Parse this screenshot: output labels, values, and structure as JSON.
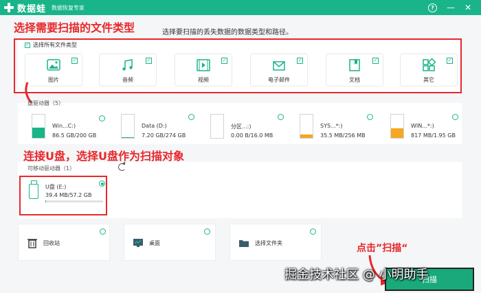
{
  "titlebar": {
    "app_name": "数据蛙",
    "app_subtitle": "数据恢复专家",
    "help_label": "?",
    "minimize_label": "—",
    "close_label": "✕"
  },
  "annotations": {
    "select_types": "选择需要扫描的文件类型",
    "connect_usb": "连接U盘，选择U盘作为扫描对象",
    "click_scan": "点击”扫描“"
  },
  "subtitle": "选择要扫描的丢失数据的数据类型和路径。",
  "file_types": {
    "select_all_label": "选择所有文件类型",
    "items": [
      {
        "label": "图片",
        "icon": "image-icon"
      },
      {
        "label": "音频",
        "icon": "music-icon"
      },
      {
        "label": "视频",
        "icon": "video-icon"
      },
      {
        "label": "电子邮件",
        "icon": "email-icon"
      },
      {
        "label": "文档",
        "icon": "document-icon"
      },
      {
        "label": "其它",
        "icon": "other-icon"
      }
    ]
  },
  "disks": {
    "section_label": "磁盘驱动器（5）",
    "section_label_visible": "盘驱动器（5）",
    "items": [
      {
        "name": "Win...C:)",
        "size": "86.5 GB/200 GB",
        "usage": 0.43,
        "color": "#19b48a"
      },
      {
        "name": "Data (D:)",
        "size": "7.20 GB/274 GB",
        "usage": 0.03,
        "color": "#19b48a"
      },
      {
        "name": "分区...:)",
        "size": "0.00  B/16.0 MB",
        "usage": 0.0,
        "color": "#19b48a"
      },
      {
        "name": "SYS...*:)",
        "size": "35.5 MB/256 MB",
        "usage": 0.14,
        "color": "#f5a623"
      },
      {
        "name": "WIN...*:)",
        "size": "817 MB/1.95 GB",
        "usage": 0.42,
        "color": "#f5a623"
      }
    ]
  },
  "removable": {
    "section_label": "可移动驱动器（1）",
    "usb_name": "U盘 (E:)",
    "usb_size": "39.4 MB/57.2 GB",
    "usage": 0.01
  },
  "locations": [
    {
      "label": "回收站",
      "icon": "recycle-bin-icon"
    },
    {
      "label": "桌面",
      "icon": "desktop-icon"
    },
    {
      "label": "选择文件夹",
      "icon": "folder-icon"
    }
  ],
  "scan_button": "扫描",
  "watermark": "掘金技术社区 @ 小明助手",
  "colors": {
    "accent": "#19b48a",
    "annotation": "#e8262b"
  }
}
